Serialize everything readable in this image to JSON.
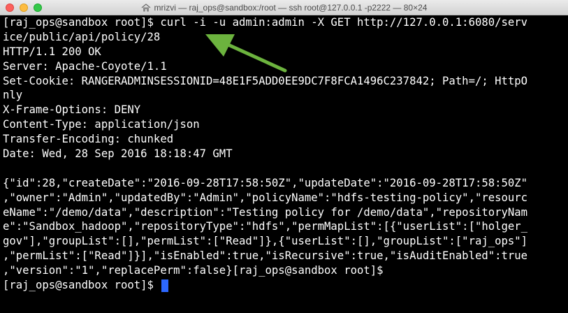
{
  "window": {
    "title": "mrizvi — raj_ops@sandbox:/root — ssh root@127.0.0.1 -p2222 — 80×24"
  },
  "icons": {
    "close": "close-button",
    "minimize": "minimize-button",
    "maximize": "zoom-button",
    "title": "home-folder-icon",
    "annotation": "green-arrow-icon"
  },
  "colors": {
    "background": "#000000",
    "text": "#ffffff",
    "cursor": "#2c67ff",
    "annotation_arrow": "#6cb33e"
  },
  "terminal": {
    "lines": [
      "[raj_ops@sandbox root]$ curl -i -u admin:admin -X GET http://127.0.0.1:6080/serv",
      "ice/public/api/policy/28",
      "HTTP/1.1 200 OK",
      "Server: Apache-Coyote/1.1",
      "Set-Cookie: RANGERADMINSESSIONID=48E1F5ADD0EE9DC7F8FCA1496C237842; Path=/; HttpO",
      "nly",
      "X-Frame-Options: DENY",
      "Content-Type: application/json",
      "Transfer-Encoding: chunked",
      "Date: Wed, 28 Sep 2016 18:18:47 GMT",
      "",
      "{\"id\":28,\"createDate\":\"2016-09-28T17:58:50Z\",\"updateDate\":\"2016-09-28T17:58:50Z\"",
      ",\"owner\":\"Admin\",\"updatedBy\":\"Admin\",\"policyName\":\"hdfs-testing-policy\",\"resourc",
      "eName\":\"/demo/data\",\"description\":\"Testing policy for /demo/data\",\"repositoryNam",
      "e\":\"Sandbox_hadoop\",\"repositoryType\":\"hdfs\",\"permMapList\":[{\"userList\":[\"holger_",
      "gov\"],\"groupList\":[],\"permList\":[\"Read\"]},{\"userList\":[],\"groupList\":[\"raj_ops\"]",
      ",\"permList\":[\"Read\"]}],\"isEnabled\":true,\"isRecursive\":true,\"isAuditEnabled\":true",
      ",\"version\":\"1\",\"replacePerm\":false}[raj_ops@sandbox root]$ "
    ],
    "prompt": "[raj_ops@sandbox root]$ "
  }
}
